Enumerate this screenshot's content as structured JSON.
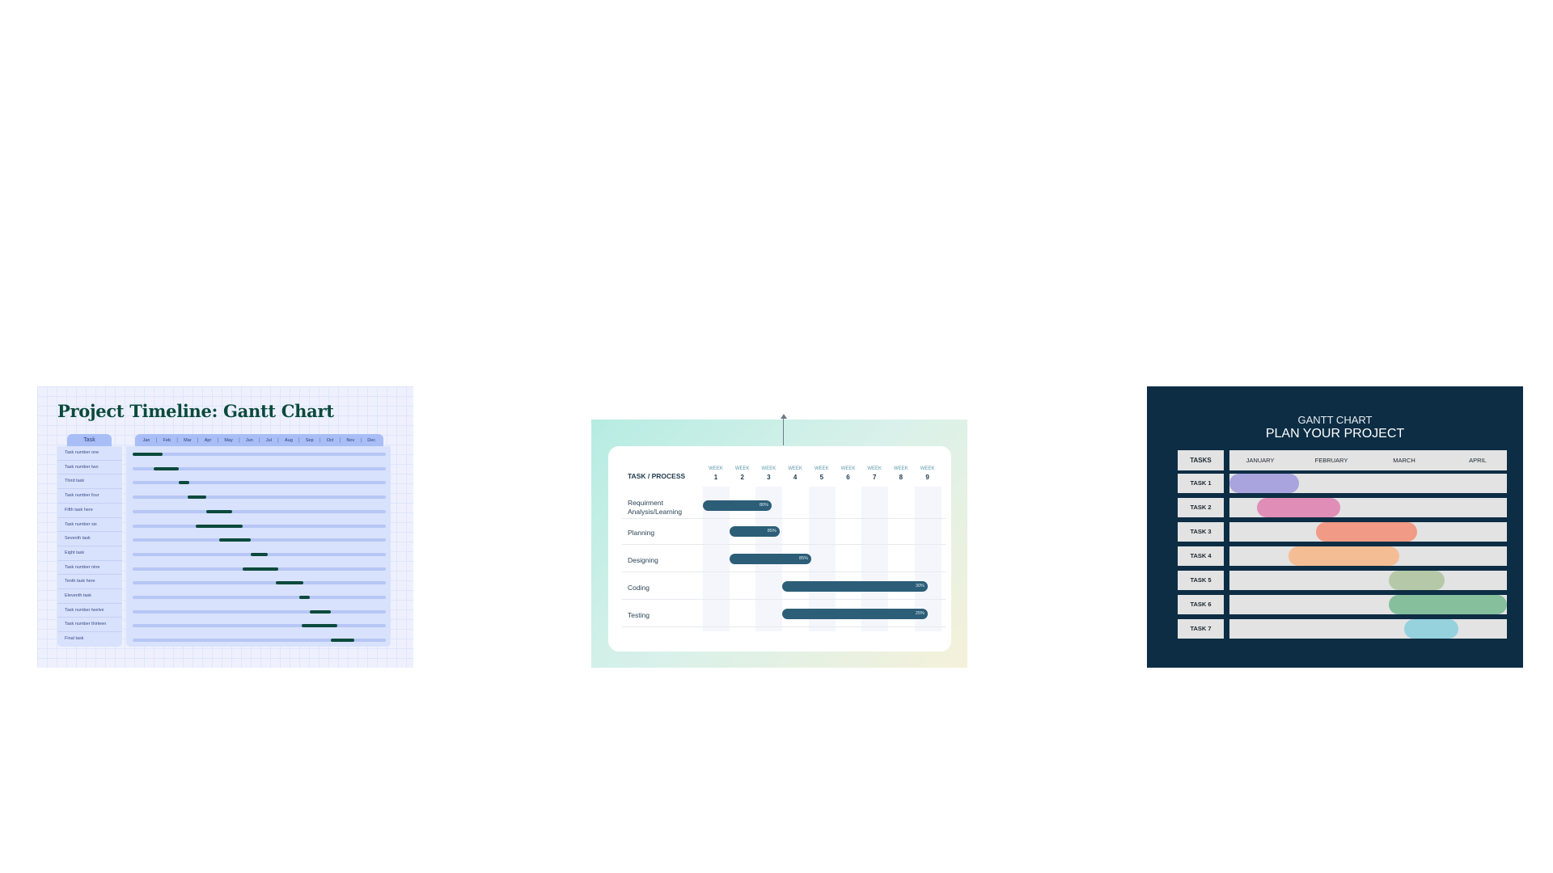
{
  "card1": {
    "title": "Project Timeline: Gantt Chart",
    "task_header": "Task",
    "months": [
      "Jan",
      "Feb",
      "Mar",
      "Apr",
      "May",
      "Jun",
      "Jul",
      "Aug",
      "Sep",
      "Oct",
      "Nov",
      "Dec"
    ],
    "tasks": [
      "Task number one",
      "Task number two",
      "Third task",
      "Task number four",
      "Fifth task here",
      "Task number six",
      "Seventh task",
      "Eight task",
      "Task number nine",
      "Tenth task here",
      "Eleventh task",
      "Task number twelve",
      "Task number thirteen",
      "Final task"
    ],
    "colors": {
      "bar": "#0b4a3d",
      "header": "#a9bef7"
    }
  },
  "card2": {
    "header": "TASK / PROCESS",
    "week_word": "WEEK",
    "weeks": [
      "1",
      "2",
      "3",
      "4",
      "5",
      "6",
      "7",
      "8",
      "9"
    ],
    "tasks": [
      {
        "label": "Requirment Analysis/Learning",
        "pct": "80%"
      },
      {
        "label": "Planning",
        "pct": "85%"
      },
      {
        "label": "Designing",
        "pct": "85%"
      },
      {
        "label": "Coding",
        "pct": "30%"
      },
      {
        "label": "Testing",
        "pct": "25%"
      }
    ],
    "colors": {
      "bar": "#2c5e78"
    }
  },
  "card3": {
    "subtitle": "GANTT CHART",
    "title": "PLAN YOUR PROJECT",
    "tasks_header": "TASKS",
    "months": [
      "JANUARY",
      "FEBRUARY",
      "MARCH",
      "APRIL"
    ],
    "tasks": [
      "TASK 1",
      "TASK 2",
      "TASK 3",
      "TASK 4",
      "TASK 5",
      "TASK 6",
      "TASK 7"
    ],
    "colors": [
      "#a9a4dd",
      "#e08db7",
      "#f19a85",
      "#f5bd94",
      "#b5c9a8",
      "#86bf9c",
      "#96d1de"
    ]
  },
  "chart_data": [
    {
      "type": "bar",
      "subtype": "gantt",
      "title": "Project Timeline: Gantt Chart",
      "categories": [
        "Task number one",
        "Task number two",
        "Third task",
        "Task number four",
        "Fifth task here",
        "Task number six",
        "Seventh task",
        "Eight task",
        "Task number nine",
        "Tenth task here",
        "Eleventh task",
        "Task number twelve",
        "Task number thirteen",
        "Final task"
      ],
      "x_ticks": [
        "Jan",
        "Feb",
        "Mar",
        "Apr",
        "May",
        "Jun",
        "Jul",
        "Aug",
        "Sep",
        "Oct",
        "Nov",
        "Dec"
      ],
      "xlim": [
        0,
        12
      ],
      "start": [
        0.0,
        1.0,
        2.2,
        2.6,
        3.5,
        3.0,
        4.1,
        5.6,
        5.2,
        6.8,
        7.9,
        8.4,
        8.0,
        9.4
      ],
      "end": [
        1.4,
        2.2,
        2.7,
        3.5,
        4.7,
        5.2,
        5.6,
        6.4,
        6.9,
        8.1,
        8.4,
        9.4,
        9.7,
        10.5
      ]
    },
    {
      "type": "bar",
      "subtype": "gantt",
      "categories": [
        "Requirment Analysis/Learning",
        "Planning",
        "Designing",
        "Coding",
        "Testing"
      ],
      "x_ticks": [
        "1",
        "2",
        "3",
        "4",
        "5",
        "6",
        "7",
        "8",
        "9"
      ],
      "xlim": [
        1,
        9
      ],
      "start": [
        1,
        2,
        2,
        4,
        4
      ],
      "end": [
        3.6,
        3.9,
        5.1,
        9.5,
        9.5
      ],
      "labels": [
        "80%",
        "85%",
        "85%",
        "30%",
        "25%"
      ]
    },
    {
      "type": "bar",
      "subtype": "gantt",
      "title": "PLAN YOUR PROJECT",
      "categories": [
        "TASK 1",
        "TASK 2",
        "TASK 3",
        "TASK 4",
        "TASK 5",
        "TASK 6",
        "TASK 7"
      ],
      "x_ticks": [
        "JANUARY",
        "FEBRUARY",
        "MARCH",
        "APRIL"
      ],
      "xlim": [
        0,
        4
      ],
      "start": [
        0.0,
        0.4,
        1.25,
        0.85,
        2.3,
        2.3,
        2.52
      ],
      "end": [
        1.0,
        1.6,
        2.7,
        2.45,
        3.1,
        4.0,
        3.3
      ]
    }
  ]
}
